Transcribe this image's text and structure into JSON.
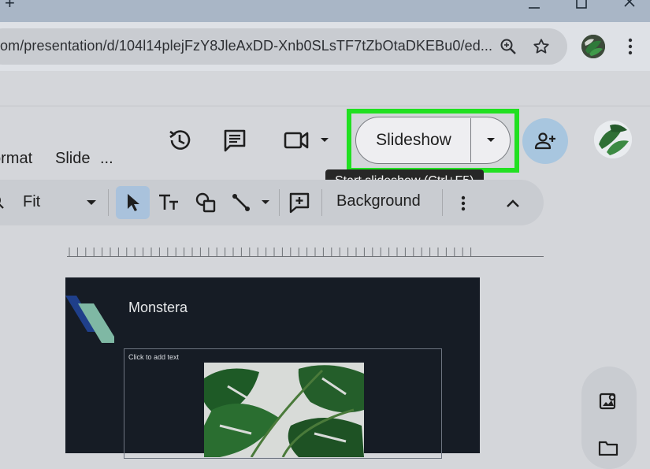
{
  "browser": {
    "url": "om/presentation/d/104l14plejFzY8JleAxDD-Xnb0SLsTF7tZbOtaDKEBu0/ed..."
  },
  "menu": {
    "items": [
      "ormat",
      "Slide",
      "..."
    ]
  },
  "header": {
    "slideshow_label": "Slideshow",
    "tooltip": "Start slideshow (Ctrl+F5)"
  },
  "toolbar": {
    "zoom_value": "Fit",
    "background_label": "Background"
  },
  "slide": {
    "title": "Monstera",
    "placeholder": "Click to add text"
  },
  "colors": {
    "highlight": "#21e021",
    "slide_background": "#161c25",
    "share_button": "#a8c6df",
    "selected_tool": "#a9c2dc",
    "tooltip_background": "#272727"
  },
  "icons": {
    "top_bar": [
      "new-tab-icon",
      "minimize-icon",
      "maximize-icon",
      "close-icon"
    ],
    "address_bar": [
      "zoom-icon",
      "star-icon",
      "browser-menu-icon"
    ],
    "header": [
      "history-icon",
      "comment-icon",
      "meet-icon",
      "chevron-down-icon",
      "share-person-add-icon"
    ],
    "toolbar": [
      "search-icon",
      "select-cursor-icon",
      "text-box-icon",
      "shape-icon",
      "line-icon",
      "add-comment-icon",
      "more-vert-icon",
      "chevron-up-icon"
    ],
    "side_panel": [
      "keep-icon",
      "folder-icon"
    ]
  }
}
